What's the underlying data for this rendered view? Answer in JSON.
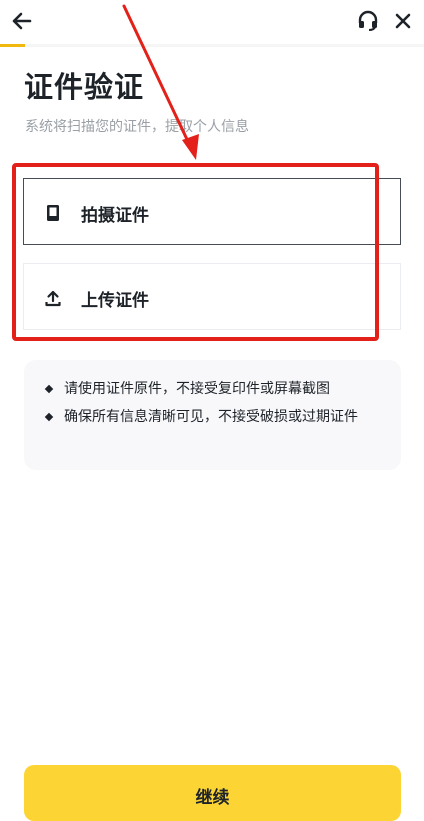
{
  "header": {
    "back_icon": "arrow-left-icon",
    "support_icon": "headset-icon",
    "close_icon": "close-icon",
    "progress_fraction": 0.06,
    "progress_color": "#f0b90b"
  },
  "main": {
    "title": "证件验证",
    "subtitle": "系统将扫描您的证件，提取个人信息",
    "options": [
      {
        "label": "拍摄证件",
        "icon": "phone-camera-icon"
      },
      {
        "label": "上传证件",
        "icon": "upload-icon"
      }
    ],
    "tips": [
      "请使用证件原件，不接受复印件或屏幕截图",
      "确保所有信息清晰可见，不接受破损或过期证件"
    ]
  },
  "footer": {
    "continue_label": "继续",
    "button_color": "#fcd535"
  },
  "annotation": {
    "color": "#e3211a"
  }
}
